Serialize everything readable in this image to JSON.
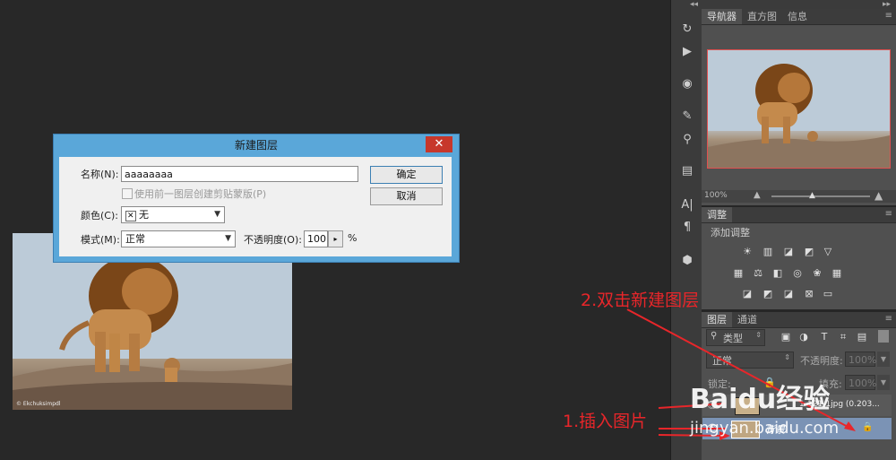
{
  "dialog": {
    "title": "新建图层",
    "close_glyph": "✕",
    "name_label": "名称(N):",
    "name_value": "aaaaaaaa",
    "clip_checkbox_label": "使用前一图层创建剪贴蒙版(P)",
    "color_label": "颜色(C):",
    "color_value": "无",
    "color_swatch_glyph": "✕",
    "mode_label": "模式(M):",
    "mode_value": "正常",
    "opacity_label": "不透明度(O):",
    "opacity_value": "100",
    "opacity_unit": "%",
    "ok_label": "确定",
    "cancel_label": "取消"
  },
  "photo": {
    "credit": "© Ekchuksimpdl"
  },
  "navigator": {
    "tabs": [
      "导航器",
      "直方图",
      "信息"
    ],
    "zoom": "100%"
  },
  "adjustments": {
    "tab": "调整",
    "title": "添加调整"
  },
  "layers": {
    "tabs": [
      "图层",
      "通道"
    ],
    "filter_kind": "类型",
    "blend_mode": "正常",
    "opacity_label": "不透明度:",
    "opacity_value": "100%",
    "lock_label": "锁定:",
    "fill_label": "填充:",
    "fill_value": "100%",
    "layer1_name": "1-121-1jpg (0.203...",
    "layer2_name": "背景"
  },
  "annotations": {
    "step2": "2.双击新建图层",
    "step1": "1.插入图片"
  },
  "watermark": {
    "brand": "Baidu经验",
    "url": "jingyan.baidu.com"
  },
  "colors": {
    "accent_red": "#e8262a",
    "dialog_blue": "#5aa7d9",
    "close_red": "#c7372b"
  }
}
